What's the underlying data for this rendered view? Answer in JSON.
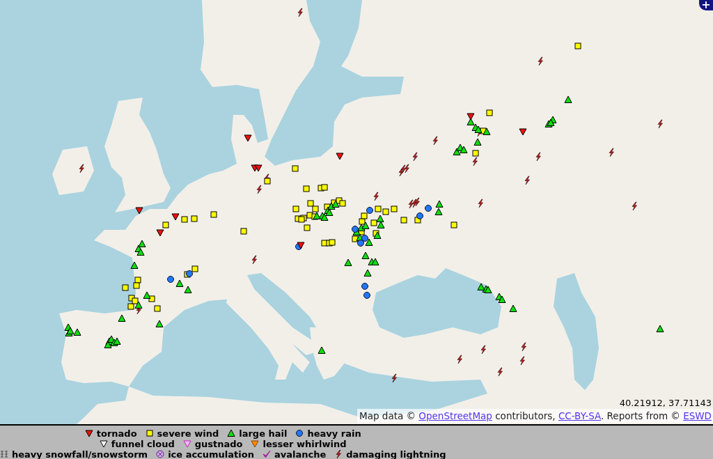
{
  "map": {
    "zoom_button": "+",
    "coordinates": "40.21912, 37.71143",
    "attribution": [
      {
        "kind": "text",
        "text": "Map data © "
      },
      {
        "kind": "link",
        "text": "OpenStreetMap"
      },
      {
        "kind": "text",
        "text": " contributors, "
      },
      {
        "kind": "link",
        "text": "CC-BY-SA"
      },
      {
        "kind": "text",
        "text": ". Reports from © "
      },
      {
        "kind": "link",
        "text": "ESWD"
      }
    ]
  },
  "legend": {
    "rows": [
      [
        {
          "kind": "tornado",
          "label": "tornado"
        },
        {
          "kind": "severe_wind",
          "label": "severe wind"
        },
        {
          "kind": "large_hail",
          "label": "large hail"
        },
        {
          "kind": "heavy_rain",
          "label": "heavy rain"
        }
      ],
      [
        {
          "kind": "funnel_cloud",
          "label": "funnel cloud"
        },
        {
          "kind": "gustnado",
          "label": "gustnado"
        },
        {
          "kind": "lesser_whirlwind",
          "label": "lesser whirlwind"
        }
      ],
      [
        {
          "kind": "heavy_snowfall",
          "label": "heavy snowfall/snowstorm"
        },
        {
          "kind": "ice_accumulation",
          "label": "ice accumulation"
        },
        {
          "kind": "avalanche",
          "label": "avalanche"
        },
        {
          "kind": "lightning",
          "label": "damaging lightning"
        }
      ]
    ]
  }
}
